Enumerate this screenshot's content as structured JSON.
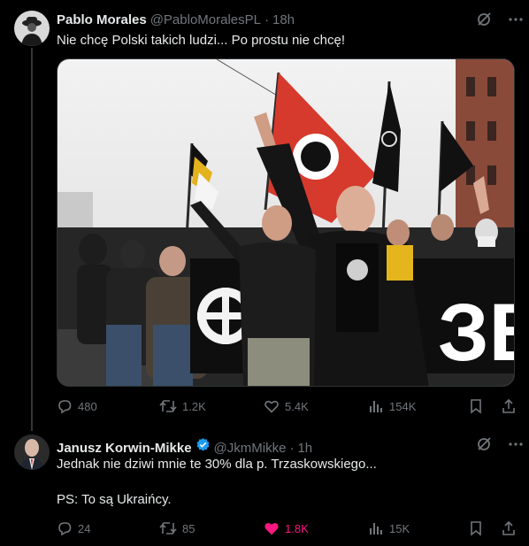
{
  "tweet1": {
    "display_name": "Pablo Morales",
    "handle": "@PabloMoralesPL",
    "time": "18h",
    "text": "Nie chcę Polski takich ludzi... Po prostu nie chcę!",
    "media_banner_text": "ЗВ",
    "replies": "480",
    "retweets": "1.2K",
    "likes": "5.4K",
    "views": "154K"
  },
  "tweet2": {
    "display_name": "Janusz Korwin-Mikke",
    "handle": "@JkmMikke",
    "time": "1h",
    "text_line1": "Jednak nie dziwi mnie te 30% dla p. Trzaskowskiego...",
    "text_line2": "PS: To są Ukraińcy.",
    "replies": "24",
    "retweets": "85",
    "likes": "1.8K",
    "views": "15K"
  },
  "colors": {
    "background": "#000000",
    "text": "#e7e9ea",
    "muted": "#71767b",
    "like_active": "#f91880",
    "verified": "#1d9bf0"
  },
  "icons": [
    "grok-icon",
    "more-icon",
    "reply-icon",
    "retweet-icon",
    "like-icon",
    "views-icon",
    "bookmark-icon",
    "share-icon",
    "verified-badge-icon"
  ]
}
